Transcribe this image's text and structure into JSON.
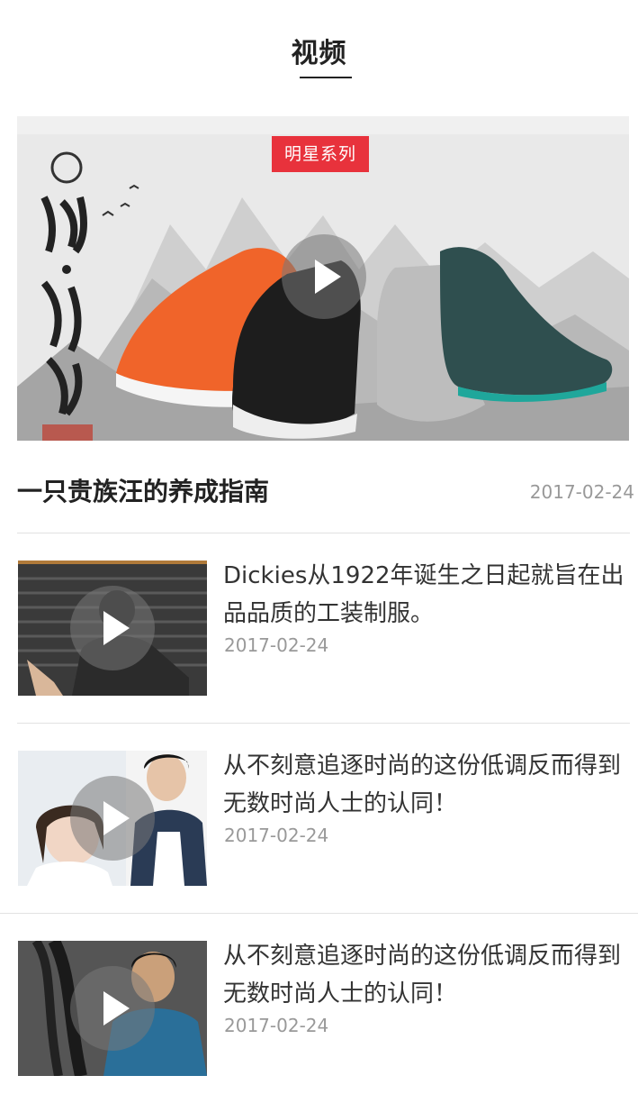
{
  "header": {
    "title": "视频"
  },
  "featured": {
    "badge": "明星系列",
    "title": "一只贵族汪的养成指南",
    "date": "2017-02-24",
    "play_icon": "play-icon"
  },
  "videos": [
    {
      "title": "Dickies从1922年诞生之日起就旨在出品品质的工装制服。",
      "date": "2017-02-24"
    },
    {
      "title": "从不刻意追逐时尚的这份低调反而得到无数时尚人士的认同！",
      "date": "2017-02-24"
    },
    {
      "title": "从不刻意追逐时尚的这份低调反而得到无数时尚人士的认同！",
      "date": "2017-02-24"
    }
  ],
  "colors": {
    "badge": "#e8323c",
    "date": "#999999",
    "divider": "#e2e2e2"
  }
}
